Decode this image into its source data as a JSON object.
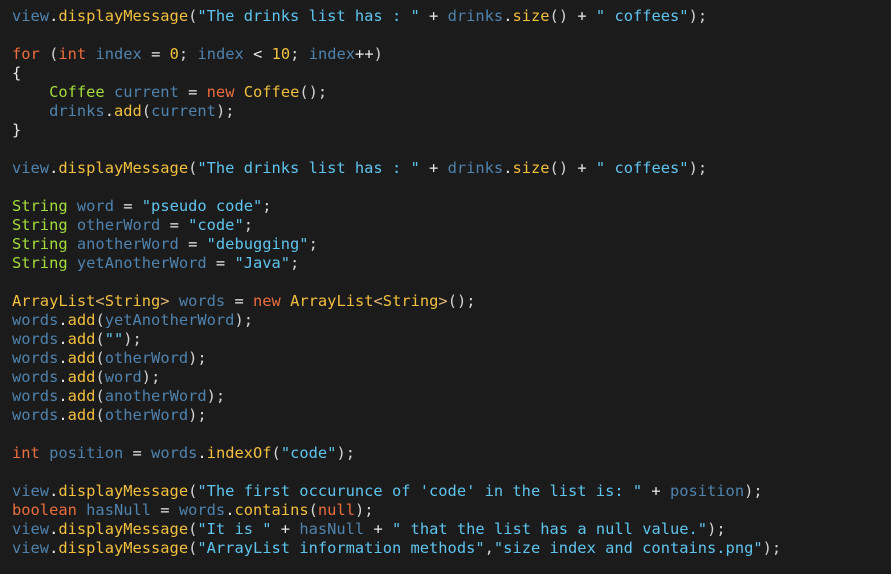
{
  "colors": {
    "background": "#1b1b1b",
    "var": "#4f82ad",
    "kw": "#ea6d3d",
    "num": "#f1c33f",
    "fn": "#f2bf3e",
    "type": "#a3dc3a",
    "str": "#5ec4ee",
    "op": "#e9e9e9",
    "punc": "#d2d2d2",
    "gen": "#e3b876",
    "plain": "#e8e8e8"
  },
  "lines": [
    [
      [
        "var",
        "view"
      ],
      [
        "op",
        "."
      ],
      [
        "fn",
        "displayMessage"
      ],
      [
        "punc",
        "("
      ],
      [
        "str",
        "\"The drinks list has : \""
      ],
      [
        "op",
        " + "
      ],
      [
        "var",
        "drinks"
      ],
      [
        "op",
        "."
      ],
      [
        "fn",
        "size"
      ],
      [
        "punc",
        "()"
      ],
      [
        "op",
        " + "
      ],
      [
        "str",
        "\" coffees\""
      ],
      [
        "punc",
        ");"
      ]
    ],
    [],
    [
      [
        "kw",
        "for"
      ],
      [
        "plain",
        " "
      ],
      [
        "punc",
        "("
      ],
      [
        "kw",
        "int"
      ],
      [
        "plain",
        " "
      ],
      [
        "var",
        "index"
      ],
      [
        "op",
        " = "
      ],
      [
        "num",
        "0"
      ],
      [
        "punc",
        "; "
      ],
      [
        "var",
        "index"
      ],
      [
        "op",
        " < "
      ],
      [
        "num",
        "10"
      ],
      [
        "punc",
        "; "
      ],
      [
        "var",
        "index"
      ],
      [
        "op",
        "++"
      ],
      [
        "punc",
        ")"
      ]
    ],
    [
      [
        "op",
        "{"
      ]
    ],
    [
      [
        "plain",
        "    "
      ],
      [
        "type",
        "Coffee"
      ],
      [
        "plain",
        " "
      ],
      [
        "var",
        "current"
      ],
      [
        "op",
        " = "
      ],
      [
        "kw",
        "new"
      ],
      [
        "plain",
        " "
      ],
      [
        "fn",
        "Coffee"
      ],
      [
        "punc",
        "();"
      ]
    ],
    [
      [
        "plain",
        "    "
      ],
      [
        "var",
        "drinks"
      ],
      [
        "op",
        "."
      ],
      [
        "fn",
        "add"
      ],
      [
        "punc",
        "("
      ],
      [
        "var",
        "current"
      ],
      [
        "punc",
        ");"
      ]
    ],
    [
      [
        "op",
        "}"
      ]
    ],
    [],
    [
      [
        "var",
        "view"
      ],
      [
        "op",
        "."
      ],
      [
        "fn",
        "displayMessage"
      ],
      [
        "punc",
        "("
      ],
      [
        "str",
        "\"The drinks list has : \""
      ],
      [
        "op",
        " + "
      ],
      [
        "var",
        "drinks"
      ],
      [
        "op",
        "."
      ],
      [
        "fn",
        "size"
      ],
      [
        "punc",
        "()"
      ],
      [
        "op",
        " + "
      ],
      [
        "str",
        "\" coffees\""
      ],
      [
        "punc",
        ");"
      ]
    ],
    [],
    [
      [
        "type",
        "String"
      ],
      [
        "plain",
        " "
      ],
      [
        "var",
        "word"
      ],
      [
        "op",
        " = "
      ],
      [
        "str",
        "\"pseudo code\""
      ],
      [
        "punc",
        ";"
      ]
    ],
    [
      [
        "type",
        "String"
      ],
      [
        "plain",
        " "
      ],
      [
        "var",
        "otherWord"
      ],
      [
        "op",
        " = "
      ],
      [
        "str",
        "\"code\""
      ],
      [
        "punc",
        ";"
      ]
    ],
    [
      [
        "type",
        "String"
      ],
      [
        "plain",
        " "
      ],
      [
        "var",
        "anotherWord"
      ],
      [
        "op",
        " = "
      ],
      [
        "str",
        "\"debugging\""
      ],
      [
        "punc",
        ";"
      ]
    ],
    [
      [
        "type",
        "String"
      ],
      [
        "plain",
        " "
      ],
      [
        "var",
        "yetAnotherWord"
      ],
      [
        "op",
        " = "
      ],
      [
        "str",
        "\"Java\""
      ],
      [
        "punc",
        ";"
      ]
    ],
    [],
    [
      [
        "fn",
        "ArrayList"
      ],
      [
        "gen",
        "<"
      ],
      [
        "fn",
        "String"
      ],
      [
        "gen",
        ">"
      ],
      [
        "plain",
        " "
      ],
      [
        "var",
        "words"
      ],
      [
        "op",
        " = "
      ],
      [
        "kw",
        "new"
      ],
      [
        "plain",
        " "
      ],
      [
        "fn",
        "ArrayList"
      ],
      [
        "gen",
        "<"
      ],
      [
        "fn",
        "String"
      ],
      [
        "gen",
        ">"
      ],
      [
        "punc",
        "();"
      ]
    ],
    [
      [
        "var",
        "words"
      ],
      [
        "op",
        "."
      ],
      [
        "fn",
        "add"
      ],
      [
        "punc",
        "("
      ],
      [
        "var",
        "yetAnotherWord"
      ],
      [
        "punc",
        ");"
      ]
    ],
    [
      [
        "var",
        "words"
      ],
      [
        "op",
        "."
      ],
      [
        "fn",
        "add"
      ],
      [
        "punc",
        "("
      ],
      [
        "str",
        "\"\""
      ],
      [
        "punc",
        ");"
      ]
    ],
    [
      [
        "var",
        "words"
      ],
      [
        "op",
        "."
      ],
      [
        "fn",
        "add"
      ],
      [
        "punc",
        "("
      ],
      [
        "var",
        "otherWord"
      ],
      [
        "punc",
        ");"
      ]
    ],
    [
      [
        "var",
        "words"
      ],
      [
        "op",
        "."
      ],
      [
        "fn",
        "add"
      ],
      [
        "punc",
        "("
      ],
      [
        "var",
        "word"
      ],
      [
        "punc",
        ");"
      ]
    ],
    [
      [
        "var",
        "words"
      ],
      [
        "op",
        "."
      ],
      [
        "fn",
        "add"
      ],
      [
        "punc",
        "("
      ],
      [
        "var",
        "anotherWord"
      ],
      [
        "punc",
        ");"
      ]
    ],
    [
      [
        "var",
        "words"
      ],
      [
        "op",
        "."
      ],
      [
        "fn",
        "add"
      ],
      [
        "punc",
        "("
      ],
      [
        "var",
        "otherWord"
      ],
      [
        "punc",
        ");"
      ]
    ],
    [],
    [
      [
        "kw",
        "int"
      ],
      [
        "plain",
        " "
      ],
      [
        "var",
        "position"
      ],
      [
        "op",
        " = "
      ],
      [
        "var",
        "words"
      ],
      [
        "op",
        "."
      ],
      [
        "fn",
        "indexOf"
      ],
      [
        "punc",
        "("
      ],
      [
        "str",
        "\"code\""
      ],
      [
        "punc",
        ");"
      ]
    ],
    [],
    [
      [
        "var",
        "view"
      ],
      [
        "op",
        "."
      ],
      [
        "fn",
        "displayMessage"
      ],
      [
        "punc",
        "("
      ],
      [
        "str",
        "\"The first occurunce of 'code' in the list is: \""
      ],
      [
        "op",
        " + "
      ],
      [
        "var",
        "position"
      ],
      [
        "punc",
        ");"
      ]
    ],
    [
      [
        "kw",
        "boolean"
      ],
      [
        "plain",
        " "
      ],
      [
        "var",
        "hasNull"
      ],
      [
        "op",
        " = "
      ],
      [
        "var",
        "words"
      ],
      [
        "op",
        "."
      ],
      [
        "fn",
        "contains"
      ],
      [
        "punc",
        "("
      ],
      [
        "kw",
        "null"
      ],
      [
        "punc",
        ");"
      ]
    ],
    [
      [
        "var",
        "view"
      ],
      [
        "op",
        "."
      ],
      [
        "fn",
        "displayMessage"
      ],
      [
        "punc",
        "("
      ],
      [
        "str",
        "\"It is \""
      ],
      [
        "op",
        " + "
      ],
      [
        "var",
        "hasNull"
      ],
      [
        "op",
        " + "
      ],
      [
        "str",
        "\" that the list has a null value.\""
      ],
      [
        "punc",
        ");"
      ]
    ],
    [
      [
        "var",
        "view"
      ],
      [
        "op",
        "."
      ],
      [
        "fn",
        "displayMessage"
      ],
      [
        "punc",
        "("
      ],
      [
        "str",
        "\"ArrayList information methods\""
      ],
      [
        "punc",
        ","
      ],
      [
        "str",
        "\"size index and contains.png\""
      ],
      [
        "punc",
        ");"
      ]
    ]
  ]
}
